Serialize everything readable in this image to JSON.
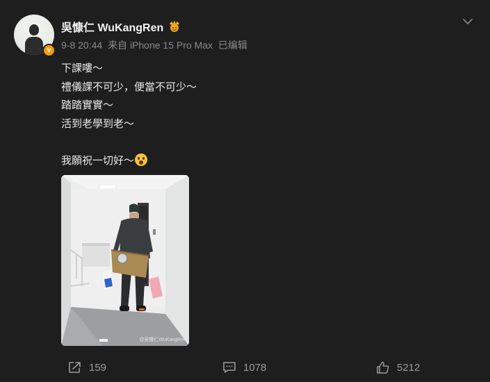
{
  "post": {
    "username": "吳慷仁 WuKangRen",
    "badge_letter": "v",
    "meta": {
      "date": "9-8 20:44",
      "source": "来自 iPhone 15 Pro Max",
      "edited": "已编辑"
    },
    "lines": [
      "下課嘍～",
      "禮儀課不可少，便當不可少～",
      "踏踏實實～",
      "活到老學到老～"
    ],
    "last_line": "我願祝一切好～",
    "image_watermark": "@吴慷仁WuKangRen",
    "icons": {
      "crown": "crown-emoji-icon",
      "emoji": "surprised-face-emoji-icon",
      "menu": "chevron-down-icon"
    }
  },
  "actions": {
    "repost_count": "159",
    "comment_count": "1078",
    "like_count": "5212"
  },
  "colors": {
    "background": "#1e1e1e",
    "text": "#e8e8e8",
    "meta": "#8a8a8a",
    "badge": "#f39c12"
  }
}
